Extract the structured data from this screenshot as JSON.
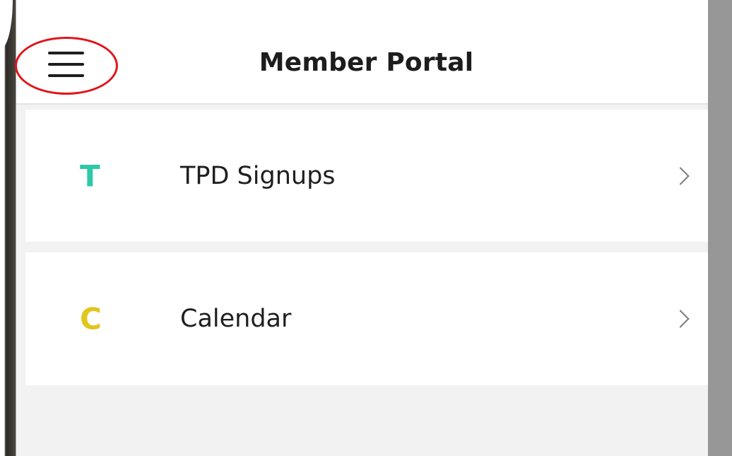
{
  "header": {
    "title": "Member Portal",
    "menu_icon": "hamburger-menu-icon",
    "highlight_color": "#e0151b"
  },
  "items": [
    {
      "letter": "T",
      "label": "TPD Signups",
      "letter_color": "#2ec9a7",
      "chevron_icon": "chevron-right-icon"
    },
    {
      "letter": "C",
      "label": "Calendar",
      "letter_color": "#e3c51b",
      "chevron_icon": "chevron-right-icon"
    }
  ]
}
